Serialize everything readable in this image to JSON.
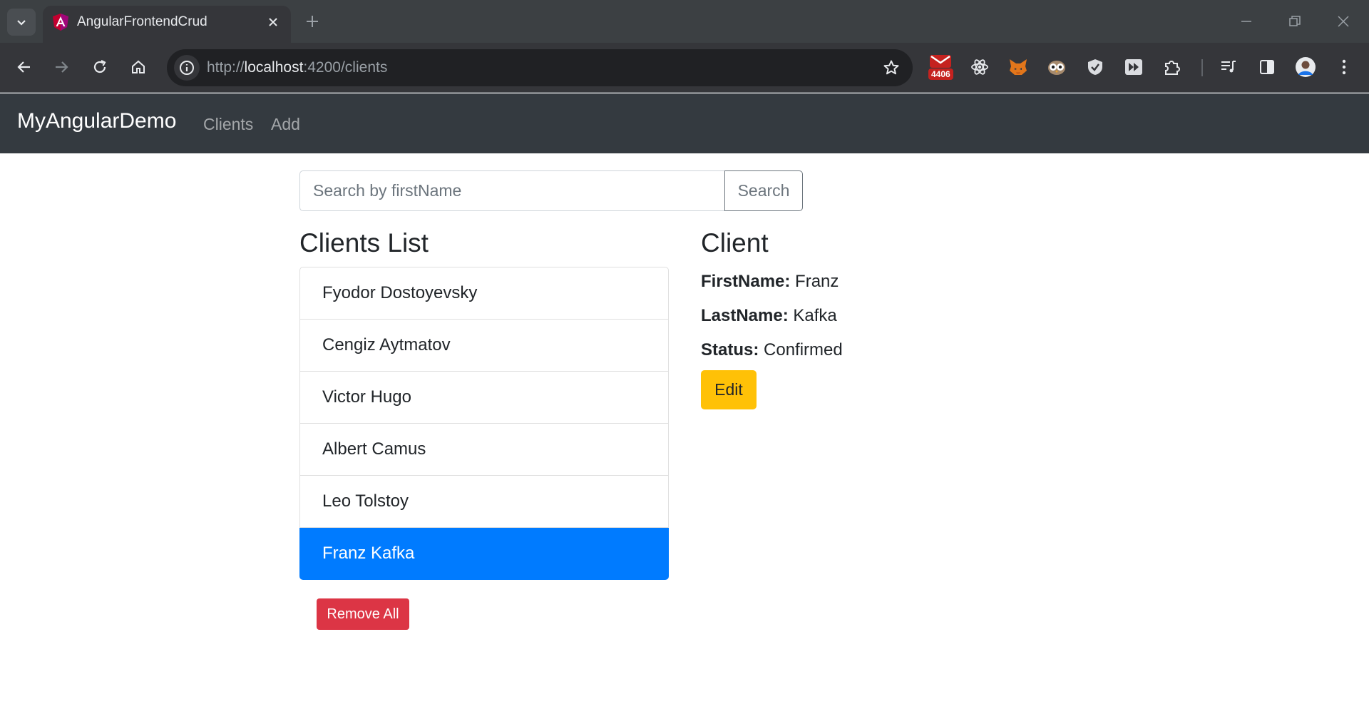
{
  "browser": {
    "tab_title": "AngularFrontendCrud",
    "url_scheme": "http://",
    "url_host": "localhost",
    "url_rest": ":4200/clients",
    "extension_badge": "4406"
  },
  "navbar": {
    "brand": "MyAngularDemo",
    "links": [
      {
        "label": "Clients"
      },
      {
        "label": "Add"
      }
    ]
  },
  "search": {
    "placeholder": "Search by firstName",
    "value": "",
    "button_label": "Search"
  },
  "clients_list": {
    "title": "Clients List",
    "items": [
      {
        "name": "Fyodor Dostoyevsky"
      },
      {
        "name": "Cengiz Aytmatov"
      },
      {
        "name": "Victor Hugo"
      },
      {
        "name": "Albert Camus"
      },
      {
        "name": "Leo Tolstoy"
      },
      {
        "name": "Franz Kafka",
        "active": true
      }
    ],
    "remove_all_label": "Remove All"
  },
  "client_detail": {
    "title": "Client",
    "first_name_label": "FirstName:",
    "first_name": "Franz",
    "last_name_label": "LastName:",
    "last_name": "Kafka",
    "status_label": "Status:",
    "status": "Confirmed",
    "edit_label": "Edit"
  },
  "colors": {
    "navbar_bg": "#343a40",
    "active_item": "#007bff",
    "danger": "#dc3545",
    "warning": "#ffc107"
  }
}
